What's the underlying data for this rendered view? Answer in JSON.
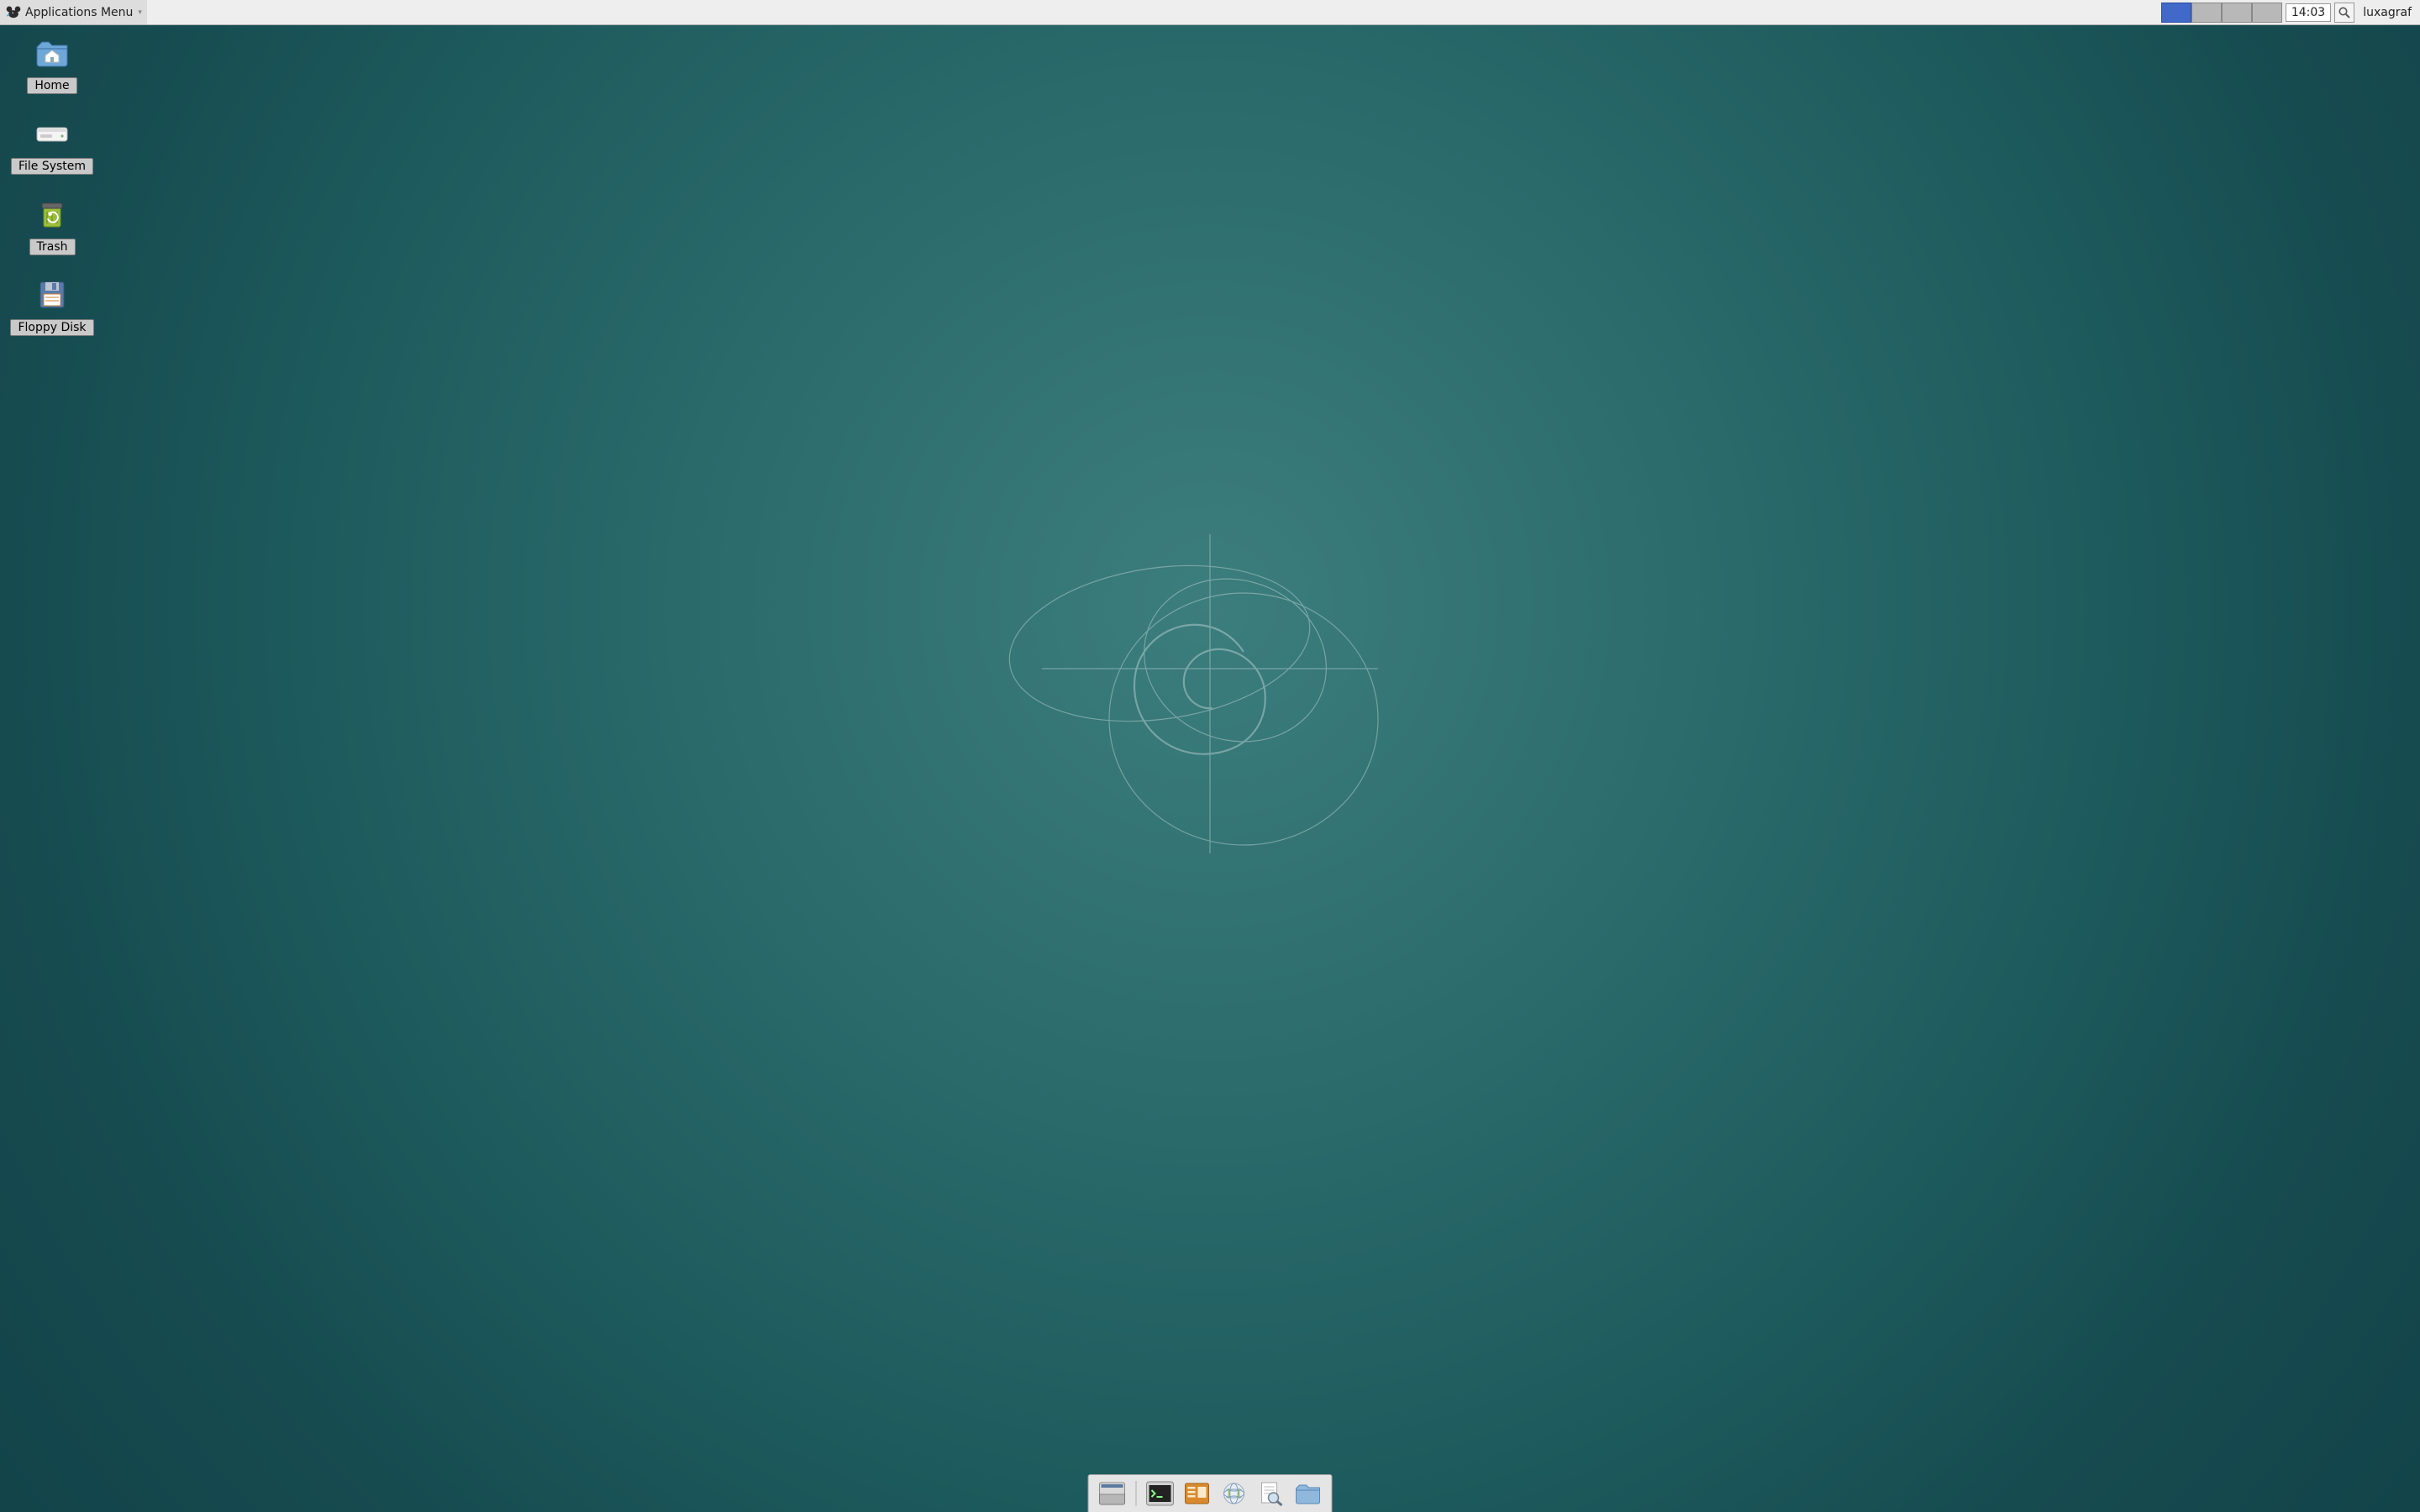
{
  "panel": {
    "applications_menu_label": "Applications Menu",
    "workspace_count": 4,
    "active_workspace": 0,
    "clock": "14:03",
    "tray_icon": "magnifier-icon",
    "username": "luxagraf"
  },
  "desktop_icons": [
    {
      "id": "home",
      "label": "Home",
      "icon": "home-folder-icon"
    },
    {
      "id": "filesystem",
      "label": "File System",
      "icon": "drive-icon"
    },
    {
      "id": "trash",
      "label": "Trash",
      "icon": "trash-icon"
    },
    {
      "id": "floppy",
      "label": "Floppy Disk",
      "icon": "floppy-icon"
    }
  ],
  "dock": [
    {
      "id": "show-desktop",
      "icon": "show-desktop-icon"
    },
    {
      "id": "terminal",
      "icon": "terminal-icon"
    },
    {
      "id": "files",
      "icon": "file-manager-icon"
    },
    {
      "id": "browser",
      "icon": "web-browser-icon"
    },
    {
      "id": "find",
      "icon": "document-find-icon"
    },
    {
      "id": "folder",
      "icon": "folder-icon"
    }
  ]
}
